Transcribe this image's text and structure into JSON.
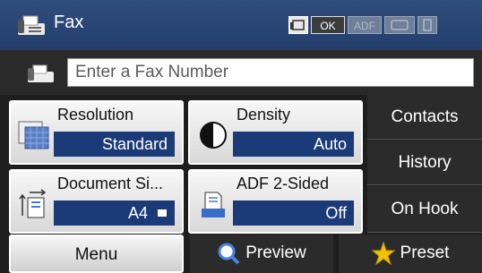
{
  "header": {
    "title": "Fax",
    "status_icons": [
      {
        "name": "fax-mode-icon",
        "text": ""
      },
      {
        "name": "ok-status-icon",
        "text": "OK"
      },
      {
        "name": "adf-icon",
        "text": "ADF"
      },
      {
        "name": "scanner-icon",
        "text": ""
      },
      {
        "name": "memory-icon",
        "text": ""
      }
    ]
  },
  "fax_number": {
    "placeholder": "Enter a Fax Number",
    "value": ""
  },
  "settings": {
    "resolution": {
      "label": "Resolution",
      "value": "Standard"
    },
    "density": {
      "label": "Density",
      "value": "Auto"
    },
    "document_size": {
      "label": "Document Si...",
      "value": "A4"
    },
    "adf_2sided": {
      "label": "ADF 2-Sided",
      "value": "Off"
    }
  },
  "side_buttons": {
    "contacts": "Contacts",
    "history": "History",
    "on_hook": "On Hook"
  },
  "bottom_bar": {
    "menu": "Menu",
    "preview": "Preview",
    "preset": "Preset"
  },
  "colors": {
    "header_blue": "#2f4d7e",
    "value_blue": "#1b3b78",
    "button_dark": "#2b2b2b",
    "preset_star": "#f2c200"
  }
}
